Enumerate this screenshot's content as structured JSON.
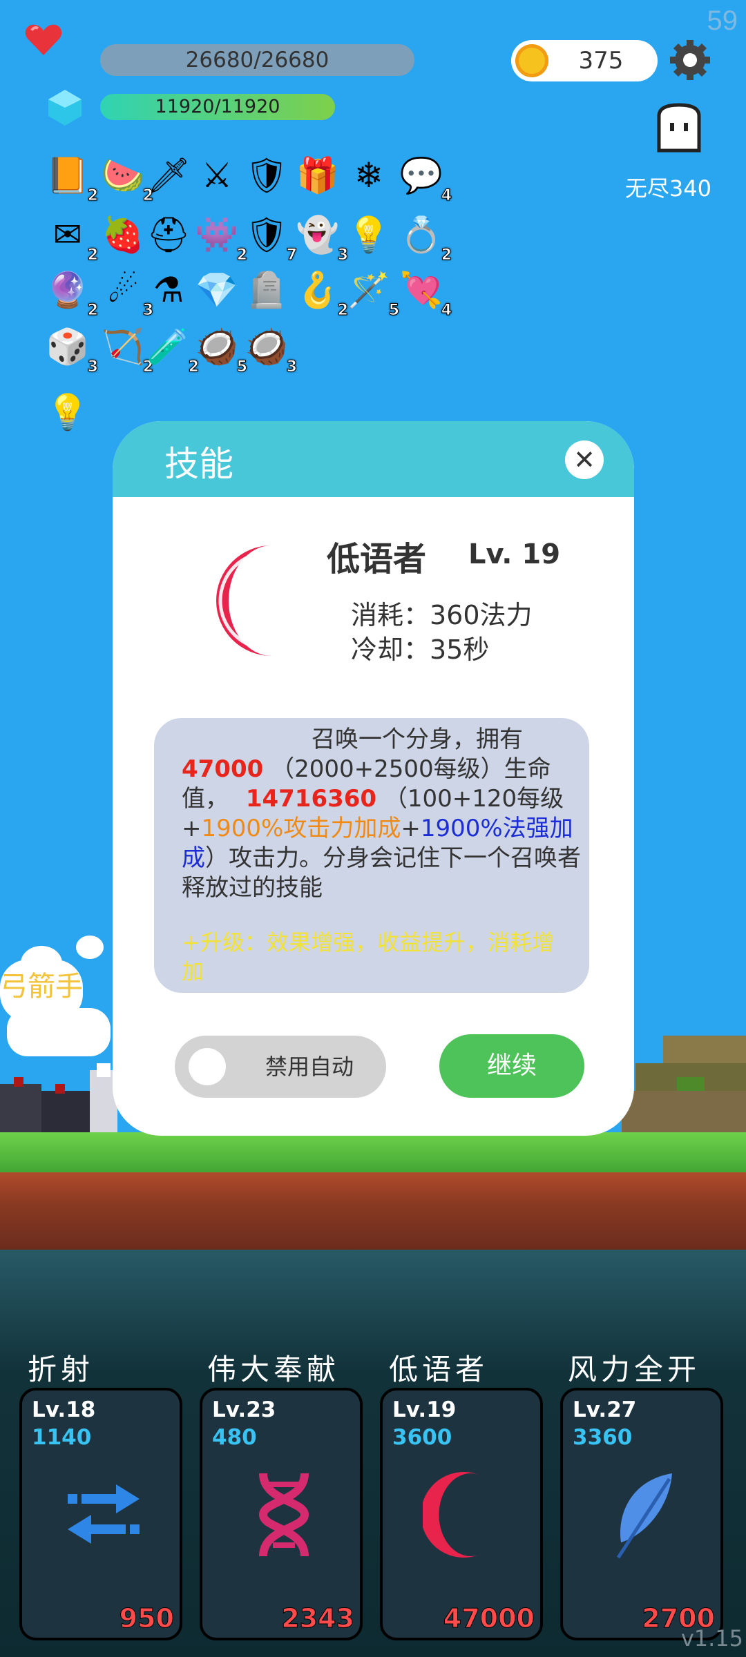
{
  "status": {
    "fps": "59",
    "hp": "26680/26680",
    "mp": "11920/11920",
    "coins": "375",
    "endless": "无尽340"
  },
  "items": [
    {
      "icon": "book-icon",
      "glyph": "📙",
      "count": "2"
    },
    {
      "icon": "watermelon-icon",
      "glyph": "🍉",
      "count": "2"
    },
    {
      "icon": "sword-icon",
      "glyph": "🗡",
      "count": ""
    },
    {
      "icon": "steel-sword-icon",
      "glyph": "⚔",
      "count": ""
    },
    {
      "icon": "shield-icon",
      "glyph": "🛡",
      "count": ""
    },
    {
      "icon": "purple-chest-icon",
      "glyph": "🎁",
      "count": ""
    },
    {
      "icon": "snowflake-icon",
      "glyph": "❄",
      "count": ""
    },
    {
      "icon": "chat-bubble-icon",
      "glyph": "💬",
      "count": "4"
    },
    {
      "icon": "envelope-icon",
      "glyph": "✉",
      "count": "2"
    },
    {
      "icon": "strawberry-icon",
      "glyph": "🍓",
      "count": ""
    },
    {
      "icon": "viking-helmet-icon",
      "glyph": "⛑",
      "count": ""
    },
    {
      "icon": "green-spirit-icon",
      "glyph": "👾",
      "count": "2"
    },
    {
      "icon": "red-shield-icon",
      "glyph": "🛡",
      "count": "7"
    },
    {
      "icon": "ghost-icon",
      "glyph": "👻",
      "count": "3"
    },
    {
      "icon": "lightbulb-icon",
      "glyph": "💡",
      "count": ""
    },
    {
      "icon": "ring-icon",
      "glyph": "💍",
      "count": "2"
    },
    {
      "icon": "crystal-ball-icon",
      "glyph": "🔮",
      "count": "2"
    },
    {
      "icon": "meteor-icon",
      "glyph": "☄",
      "count": "3"
    },
    {
      "icon": "cauldron-icon",
      "glyph": "⚗",
      "count": ""
    },
    {
      "icon": "sapphire-icon",
      "glyph": "💎",
      "count": ""
    },
    {
      "icon": "tombstone-icon",
      "glyph": "🪦",
      "count": ""
    },
    {
      "icon": "hook-icon",
      "glyph": "🪝",
      "count": "2"
    },
    {
      "icon": "magic-wand-icon",
      "glyph": "🪄",
      "count": "5"
    },
    {
      "icon": "heart-arrow-icon",
      "glyph": "💘",
      "count": "4"
    },
    {
      "icon": "dice-icon",
      "glyph": "🎲",
      "count": "3"
    },
    {
      "icon": "crossbow-icon",
      "glyph": "🏹",
      "count": "2"
    },
    {
      "icon": "potion-icon",
      "glyph": "🧪",
      "count": "2"
    },
    {
      "icon": "coconut-drink-icon",
      "glyph": "🥥",
      "count": "5"
    },
    {
      "icon": "coconut-icon",
      "glyph": "🥥",
      "count": "3"
    },
    {
      "icon": "lightbulb-block-icon",
      "glyph": "💡",
      "count": ""
    }
  ],
  "scene": {
    "enemy_label": "弓箭手"
  },
  "modal": {
    "title": "技能",
    "skill_name": "低语者",
    "skill_level": "Lv. 19",
    "cost": "消耗：360法力",
    "cooldown": "冷却：35秒",
    "desc": {
      "p1": "召唤一个分身，拥有",
      "hp_value": "47000",
      "p2": "（2000+2500每级）生命值，",
      "atk_value": "14716360",
      "p3": "（100+120每级",
      "plus1": "+",
      "atk_bonus": "1900%攻击力加成",
      "plus2": "+",
      "mag_bonus": "1900%法强加成",
      "p4": "）攻击力。分身会记住下一个召唤者释放过的技能"
    },
    "upgrade": "+升级：效果增强，收益提升，消耗增加",
    "toggle_label": "禁用自动",
    "continue_label": "继续"
  },
  "skills": [
    {
      "name": "折射",
      "level": "Lv.18",
      "cost": "1140",
      "value": "950",
      "icon": "refract-arrows-icon",
      "color": "#2e86e6"
    },
    {
      "name": "伟大奉献",
      "level": "Lv.23",
      "cost": "480",
      "value": "2343",
      "icon": "dna-icon",
      "color": "#d62a6e"
    },
    {
      "name": "低语者",
      "level": "Lv.19",
      "cost": "3600",
      "value": "47000",
      "icon": "crescent-moon-icon",
      "color": "#e8234c"
    },
    {
      "name": "风力全开",
      "level": "Lv.27",
      "cost": "3360",
      "value": "2700",
      "icon": "feather-icon",
      "color": "#4f8fe8"
    }
  ],
  "version": "v1.15"
}
